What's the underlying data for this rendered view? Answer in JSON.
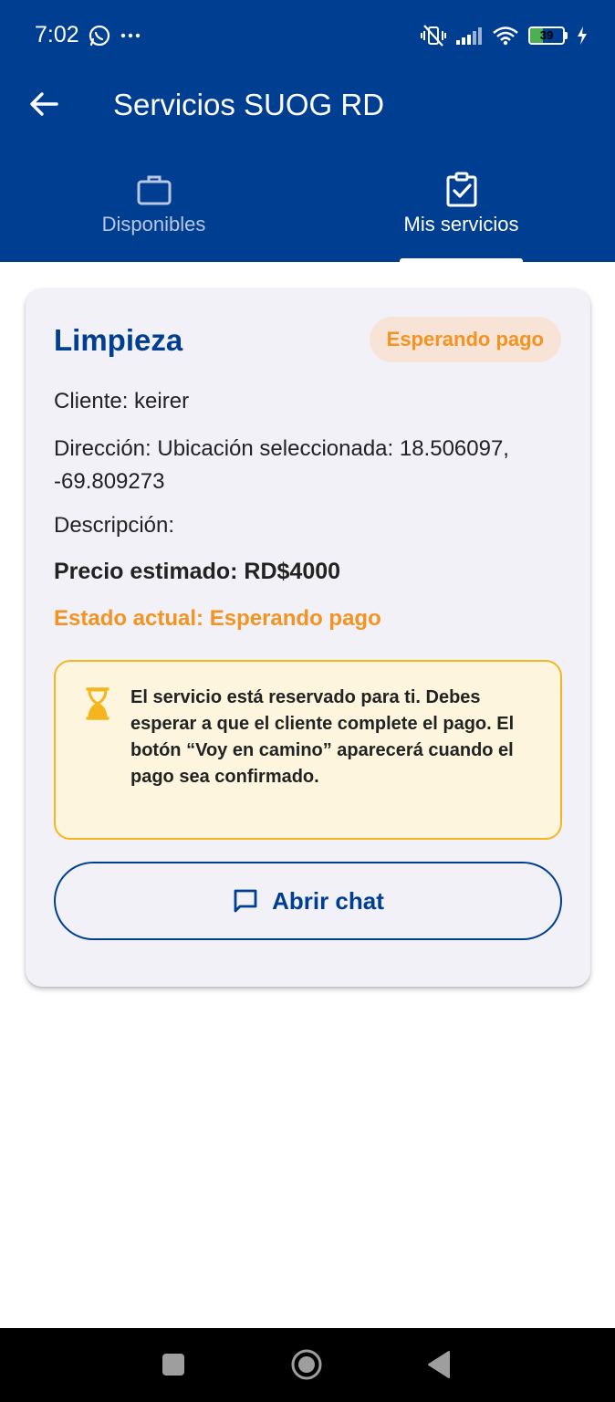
{
  "status_bar": {
    "time": "7:02",
    "battery": "39",
    "battery_level_percent": 39,
    "icons": [
      "whatsapp-icon",
      "more-dots-icon",
      "vibrate-off-icon",
      "signal-icon",
      "wifi-icon",
      "battery-icon",
      "charging-icon"
    ]
  },
  "appbar": {
    "title": "Servicios SUOG RD",
    "back_icon": "arrow-back-icon"
  },
  "tabs": [
    {
      "label": "Disponibles",
      "icon": "briefcase-icon",
      "active": false
    },
    {
      "label": "Mis servicios",
      "icon": "clipboard-check-icon",
      "active": true
    }
  ],
  "card": {
    "title": "Limpieza",
    "status_chip": "Esperando pago",
    "client": "Cliente: keirer",
    "address": "Dirección: Ubicación seleccionada: 18.506097, -69.809273",
    "description": "Descripción:",
    "price": "Precio estimado: RD$4000",
    "state": "Estado actual: Esperando pago",
    "notice": "El servicio está reservado para ti. Debes esperar a que el cliente complete el pago. El botón “Voy en camino” aparecerá cuando el pago sea confirmado.",
    "notice_icon": "hourglass-icon",
    "chat_button": "Abrir chat",
    "chat_icon": "chat-bubble-icon"
  },
  "colors": {
    "primary": "#003e91",
    "accent_orange": "#f39321",
    "chip_bg": "#f7e4d7",
    "notice_bg": "#fdf5dd",
    "notice_border": "#f5b51f",
    "card_bg": "#f2f1f8"
  },
  "nav_bar": {
    "buttons": [
      "recents-icon",
      "home-icon",
      "back-triangle-icon"
    ]
  }
}
